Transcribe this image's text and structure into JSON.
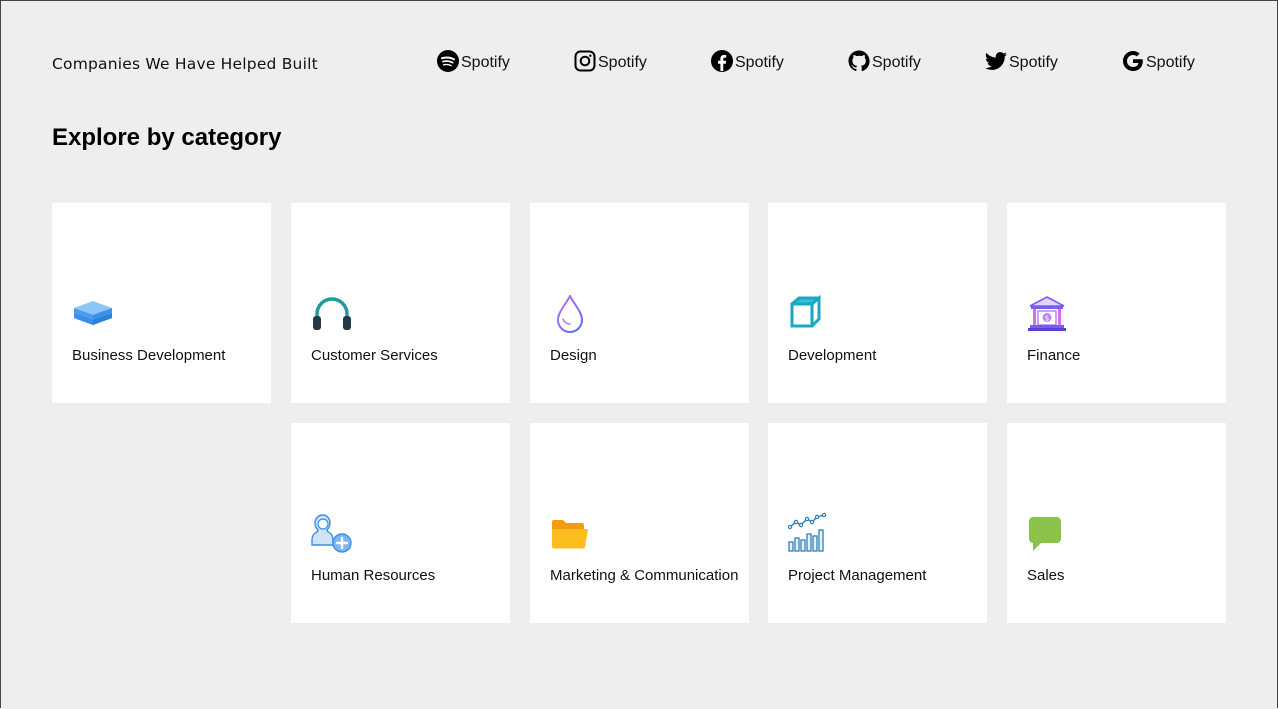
{
  "header": {
    "tagline": "Companies We Have Helped Built",
    "brands": [
      {
        "icon": "spotify-icon",
        "label": "Spotify"
      },
      {
        "icon": "instagram-icon",
        "label": "Spotify"
      },
      {
        "icon": "facebook-icon",
        "label": "Spotify"
      },
      {
        "icon": "github-icon",
        "label": "Spotify"
      },
      {
        "icon": "twitter-icon",
        "label": "Spotify"
      },
      {
        "icon": "google-icon",
        "label": "Spotify"
      }
    ]
  },
  "section": {
    "title": "Explore by category"
  },
  "categories": [
    {
      "label": "Business Development",
      "icon": "layers-icon",
      "color": "#2f8fe8"
    },
    {
      "label": "Customer Services",
      "icon": "headphones-icon",
      "color": "#1f9aa0"
    },
    {
      "label": "Design",
      "icon": "drop-icon",
      "color": "#9b6cf5"
    },
    {
      "label": "Development",
      "icon": "cube-icon",
      "color": "#19a8c2"
    },
    {
      "label": "Finance",
      "icon": "bank-icon",
      "color": "#8e5cf0"
    },
    {
      "label": "Human Resources",
      "icon": "add-user-icon",
      "color": "#3a8ee6"
    },
    {
      "label": "Marketing & Communication",
      "icon": "folder-icon",
      "color": "#f5b000"
    },
    {
      "label": "Project Management",
      "icon": "growth-chart-icon",
      "color": "#2c7fb8"
    },
    {
      "label": "Sales",
      "icon": "chat-bubble-icon",
      "color": "#8bc34a"
    }
  ]
}
